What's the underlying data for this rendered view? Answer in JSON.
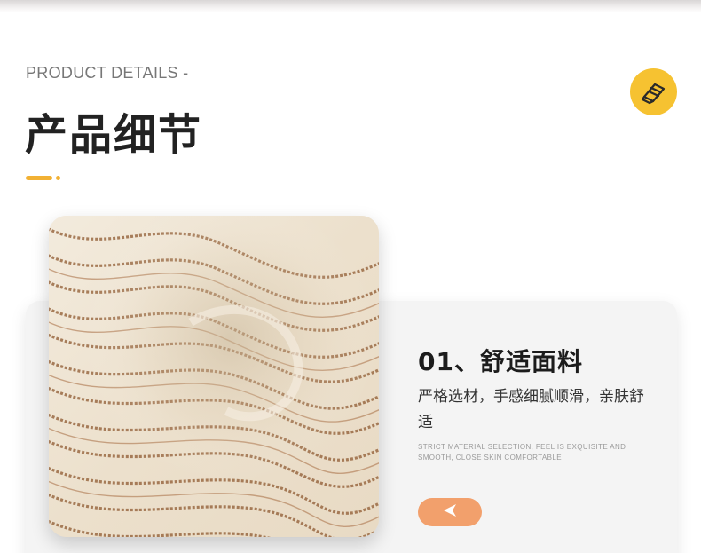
{
  "header": {
    "eyebrow": "PRODUCT DETAILS -",
    "title": "产品细节"
  },
  "icons": {
    "badge": "fabric-icon",
    "button": "arrow-left-icon"
  },
  "colors": {
    "accent": "#f2b134",
    "badge": "#f6c231",
    "button": "#f2a06c"
  },
  "feature": {
    "title": "01、舒适面料",
    "description": "严格选材，手感细腻顺滑，亲肤舒适",
    "description_en": "Strict material selection, feel is exquisite and smooth, close skin comfortable"
  }
}
